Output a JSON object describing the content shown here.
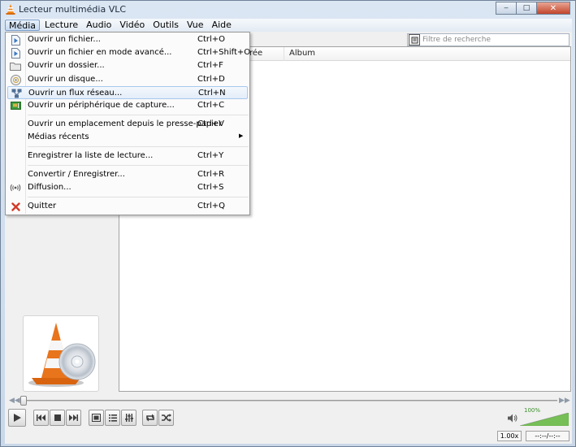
{
  "window": {
    "title": "Lecteur multimédia VLC",
    "minimize_glyph": "‒",
    "maximize_glyph": "□",
    "close_glyph": "✕"
  },
  "menubar": {
    "items": [
      "Média",
      "Lecture",
      "Audio",
      "Vidéo",
      "Outils",
      "Vue",
      "Aide"
    ],
    "active": "Média"
  },
  "media_menu": {
    "items": [
      {
        "label": "Ouvrir un fichier...",
        "shortcut": "Ctrl+O",
        "icon": "file-icon"
      },
      {
        "label": "Ouvrir un fichier en mode avancé...",
        "shortcut": "Ctrl+Shift+O",
        "icon": "file-advanced-icon"
      },
      {
        "label": "Ouvrir un dossier...",
        "shortcut": "Ctrl+F",
        "icon": "folder-icon"
      },
      {
        "label": "Ouvrir un disque...",
        "shortcut": "Ctrl+D",
        "icon": "disc-icon"
      },
      {
        "label": "Ouvrir un flux réseau...",
        "shortcut": "Ctrl+N",
        "icon": "network-icon",
        "highlighted": true
      },
      {
        "label": "Ouvrir un périphérique de capture...",
        "shortcut": "Ctrl+C",
        "icon": "capture-card-icon"
      },
      {
        "label": "Ouvrir un emplacement depuis le presse-papier",
        "shortcut": "Ctrl+V"
      },
      {
        "label": "Médias récents",
        "shortcut": "",
        "submenu_glyph": "▶"
      },
      {
        "label": "Enregistrer la liste de lecture...",
        "shortcut": "Ctrl+Y"
      },
      {
        "label": "Convertir / Enregistrer...",
        "shortcut": "Ctrl+R"
      },
      {
        "label": "Diffusion...",
        "shortcut": "Ctrl+S",
        "icon": "broadcast-icon"
      },
      {
        "label": "Quitter",
        "shortcut": "Ctrl+Q",
        "icon": "quit-x-icon"
      }
    ]
  },
  "playlist": {
    "search_placeholder": "Filtre de recherche",
    "columns": [
      "rée",
      "Album"
    ]
  },
  "volume": {
    "label": "100%",
    "level": 1.0
  },
  "status": {
    "speed": "1.00x",
    "time": "--:--/--:--"
  },
  "colors": {
    "accent": "#a8c8ef",
    "volume_green": "#5fb53b",
    "cone_orange": "#e8741c"
  }
}
